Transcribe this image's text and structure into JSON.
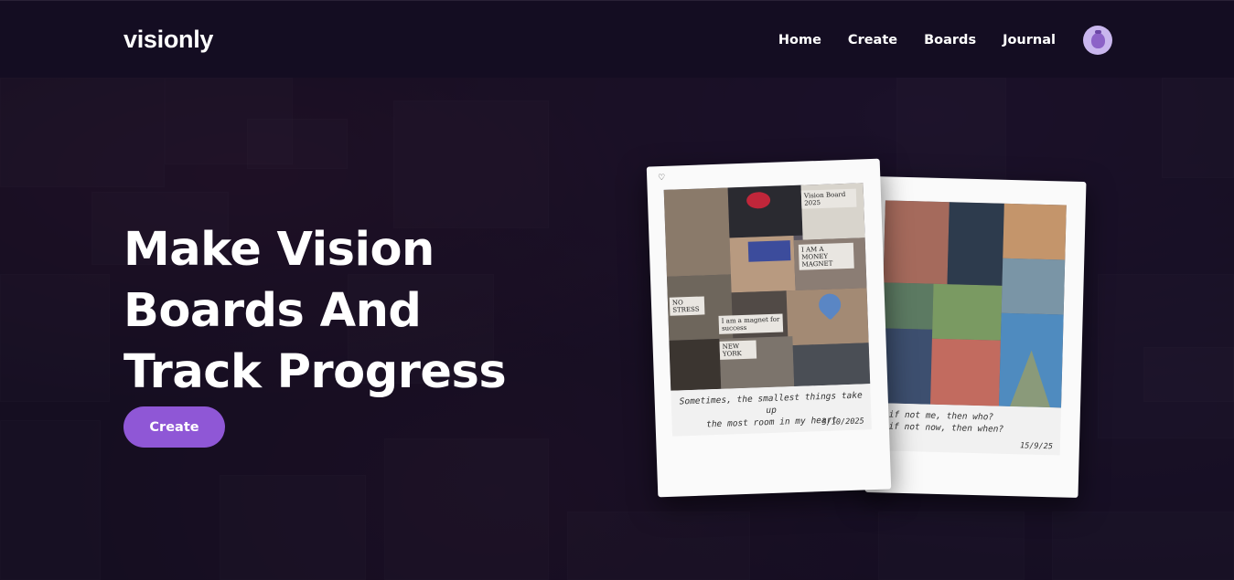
{
  "header": {
    "logo": "visionly",
    "nav": [
      {
        "label": "Home"
      },
      {
        "label": "Create"
      },
      {
        "label": "Boards"
      },
      {
        "label": "Journal"
      }
    ],
    "avatar_icon": "plum-icon"
  },
  "hero": {
    "title_lines": [
      "Make Vision",
      "Boards And",
      "Track Progress"
    ],
    "cta_label": "Create"
  },
  "polaroids": [
    {
      "caption_line1": "Sometimes, the smallest things take up",
      "caption_line2": "the most room in my heart",
      "date": "5/10/2025",
      "notes": {
        "vision_board": "Vision Board 2025",
        "money_magnet": "I AM A MONEY MAGNET",
        "success": "I am a magnet for success",
        "new_york": "NEW YORK",
        "no_stress": "NO STRESS",
        "doodle": "2025"
      }
    },
    {
      "caption_line1": "if not me, then who?",
      "caption_line2": "if not now, then when?",
      "date": "15/9/25"
    }
  ],
  "colors": {
    "accent": "#8f57d6",
    "header_bg": "#140d22",
    "page_bg": "#1b1326",
    "avatar_bg": "#c9b6ee"
  }
}
